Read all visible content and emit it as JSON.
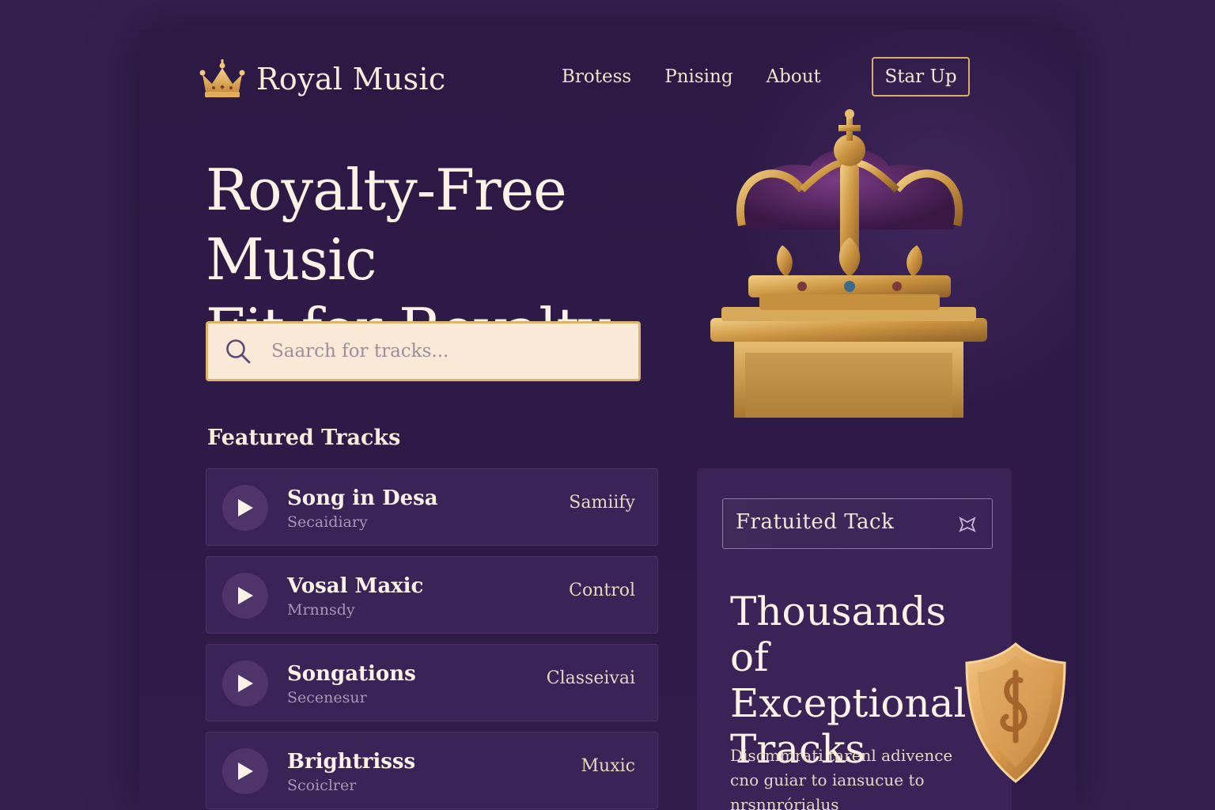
{
  "brand": {
    "name": "Royal Music",
    "logo_icon": "crown-icon"
  },
  "nav": {
    "items": [
      {
        "label": "Brotess"
      },
      {
        "label": "Pnising"
      },
      {
        "label": "About"
      }
    ],
    "cta_label": "Star Up"
  },
  "hero": {
    "title_line1": "Royalty-Free Music",
    "title_line2": "Fit for Royalty"
  },
  "search": {
    "placeholder": "Saarch for tracks...",
    "icon": "search-icon"
  },
  "featured": {
    "heading": "Featured Tracks",
    "tracks": [
      {
        "title": "Song in Desa",
        "subtitle": "Secaidiary",
        "genre": "Samiify"
      },
      {
        "title": "Vosal Maxic",
        "subtitle": "Mrnnsdy",
        "genre": "Control"
      },
      {
        "title": "Songations",
        "subtitle": "Secenesur",
        "genre": "Classeivai"
      },
      {
        "title": "Brightrisss",
        "subtitle": "Scoiclrer",
        "genre": "Muxic"
      }
    ]
  },
  "promo": {
    "tag_label": "Fratuited Tack",
    "tag_icon": "badge-icon",
    "title_line1": "Thousands of",
    "title_line2": "Exceptional",
    "title_line3": "Tracks",
    "description": "Discmmrati tarenl adivence cno guiar to iansucue to nrsnnrórialus",
    "shield_icon": "shield-icon"
  },
  "colors": {
    "background": "#34204f",
    "panel": "#2e1a47",
    "card": "#3a2356",
    "accent_gold": "#d9ad6a",
    "search_bg": "#f9e9d6",
    "text_light": "#fbf3e6"
  }
}
